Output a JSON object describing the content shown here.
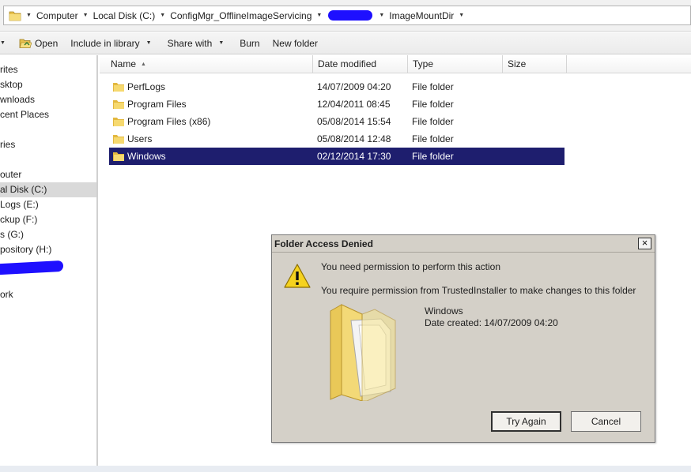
{
  "address_bar": {
    "crumbs": [
      "Computer",
      "Local Disk (C:)",
      "ConfigMgr_OfflineImageServicing",
      "ImageMountDir"
    ]
  },
  "toolbar": {
    "open_label": "Open",
    "include_label": "Include in library",
    "share_label": "Share with",
    "burn_label": "Burn",
    "new_folder_label": "New folder"
  },
  "nav_pane": {
    "items": [
      "rites",
      "sktop",
      "wnloads",
      "cent Places",
      "ries",
      "outer",
      "al Disk (C:)",
      "Logs (E:)",
      "ckup (F:)",
      "s (G:)",
      "pository (H:)",
      "ork"
    ]
  },
  "columns": {
    "name": "Name",
    "date": "Date modified",
    "type": "Type",
    "size": "Size"
  },
  "files": [
    {
      "name": "PerfLogs",
      "date": "14/07/2009 04:20",
      "type": "File folder"
    },
    {
      "name": "Program Files",
      "date": "12/04/2011 08:45",
      "type": "File folder"
    },
    {
      "name": "Program Files (x86)",
      "date": "05/08/2014 15:54",
      "type": "File folder"
    },
    {
      "name": "Users",
      "date": "05/08/2014 12:48",
      "type": "File folder"
    },
    {
      "name": "Windows",
      "date": "02/12/2014 17:30",
      "type": "File folder"
    }
  ],
  "dialog": {
    "title": "Folder Access Denied",
    "close_glyph": "×",
    "message": "You need permission to perform this action",
    "detail": "You require permission from TrustedInstaller to make changes to this folder",
    "folder_name": "Windows",
    "date_created": "Date created: 14/07/2009 04:20",
    "try_again_label": "Try Again",
    "cancel_label": "Cancel"
  },
  "colors": {
    "selection": "#1e1e6e",
    "dialog_bg": "#d4d0c8",
    "redaction": "#1e10ff",
    "folder_yellow": "#f2d36b"
  }
}
